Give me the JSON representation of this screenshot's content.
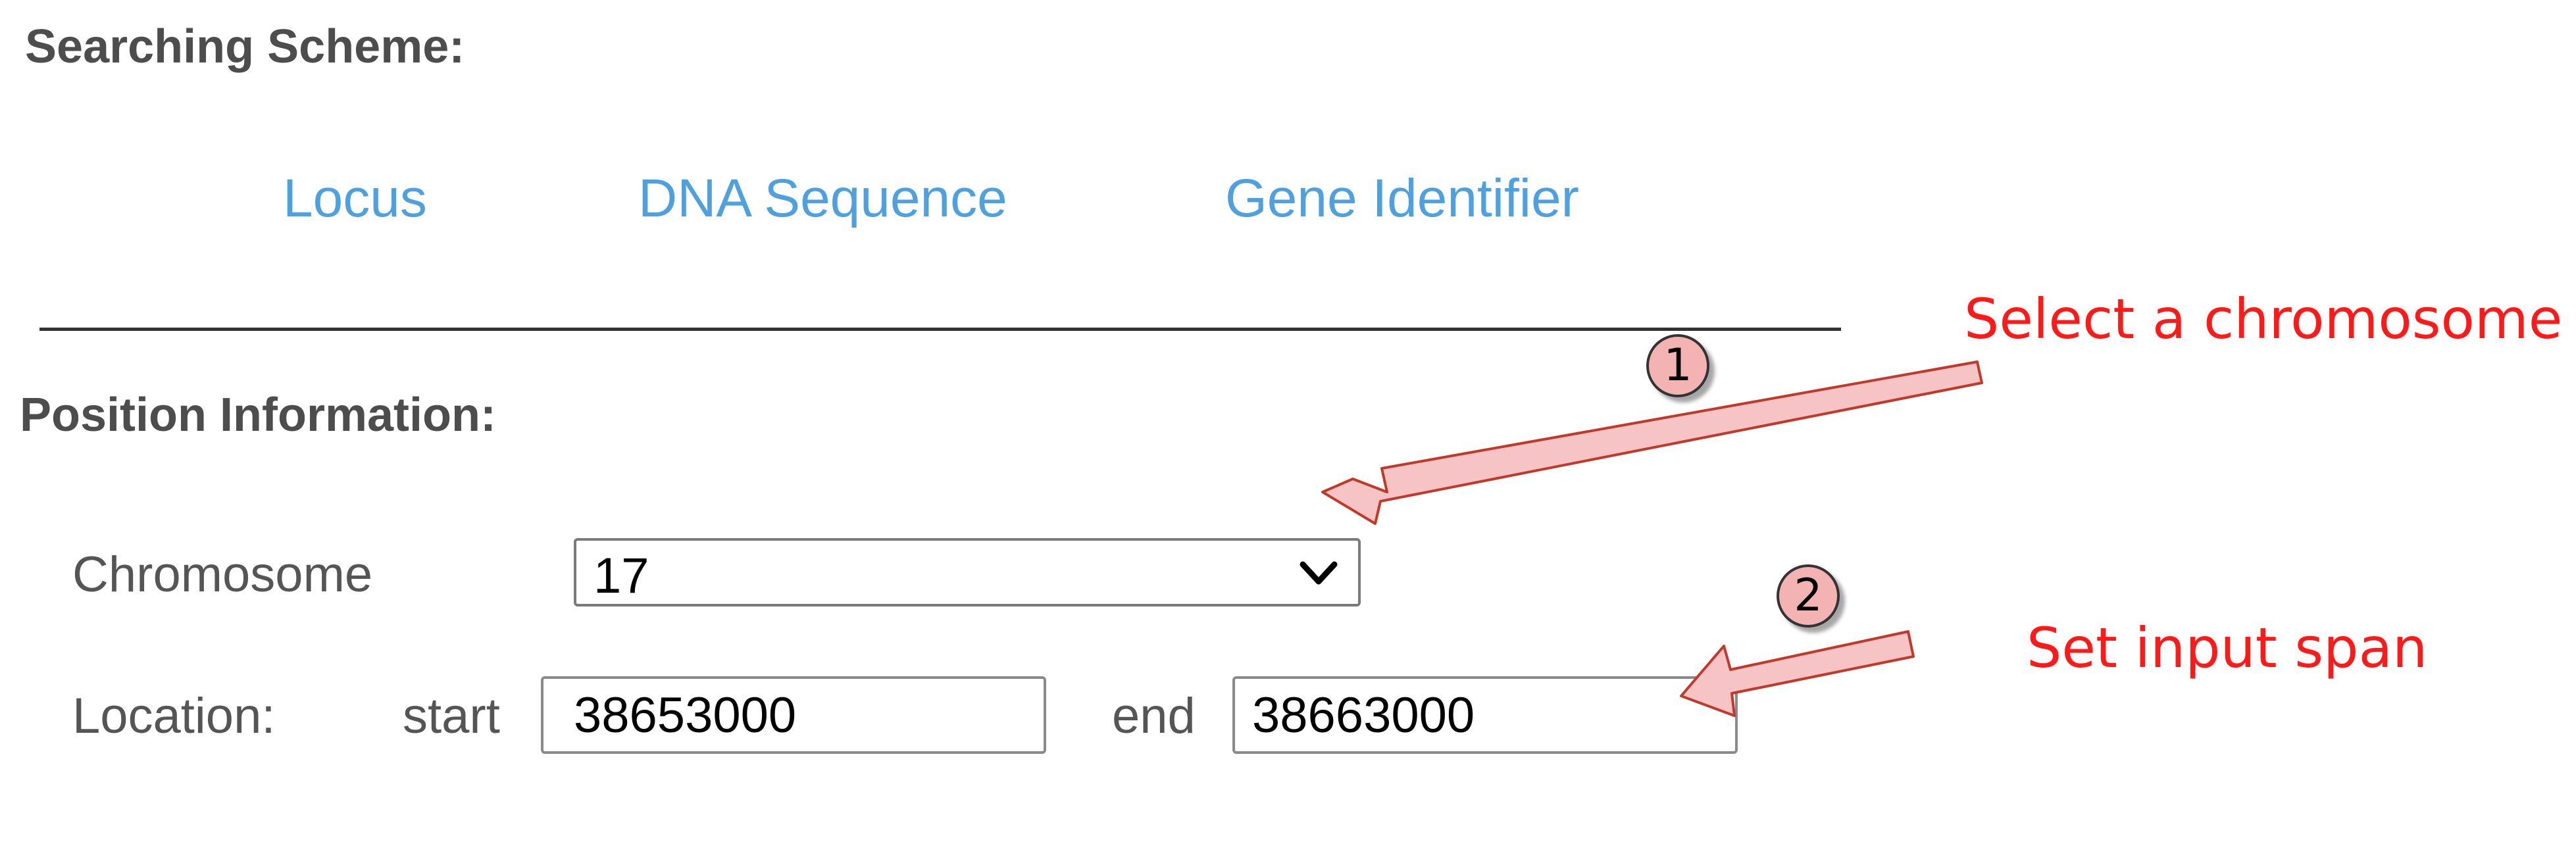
{
  "searching_scheme": {
    "heading": "Searching Scheme:",
    "tabs": [
      {
        "label": "Locus"
      },
      {
        "label": "DNA Sequence"
      },
      {
        "label": "Gene Identifier"
      }
    ]
  },
  "position_information": {
    "heading": "Position Information:",
    "chromosome": {
      "label": "Chromosome",
      "selected_value": "17"
    },
    "location": {
      "label": "Location:",
      "start_label": "start",
      "start_value": "38653000",
      "end_label": "end",
      "end_value": "38663000"
    }
  },
  "annotations": {
    "step1": {
      "number": "1",
      "text": "Select a chromosome"
    },
    "step2": {
      "number": "2",
      "text": "Set input span"
    }
  },
  "colors": {
    "link": "#4ea1de",
    "annotation_text": "#ff1a1a",
    "arrow_fill": "#f6c4c4",
    "arrow_stroke": "#c0392b",
    "badge_fill": "#f4b3b3"
  },
  "icons": {
    "dropdown": "chevron-down-icon"
  }
}
